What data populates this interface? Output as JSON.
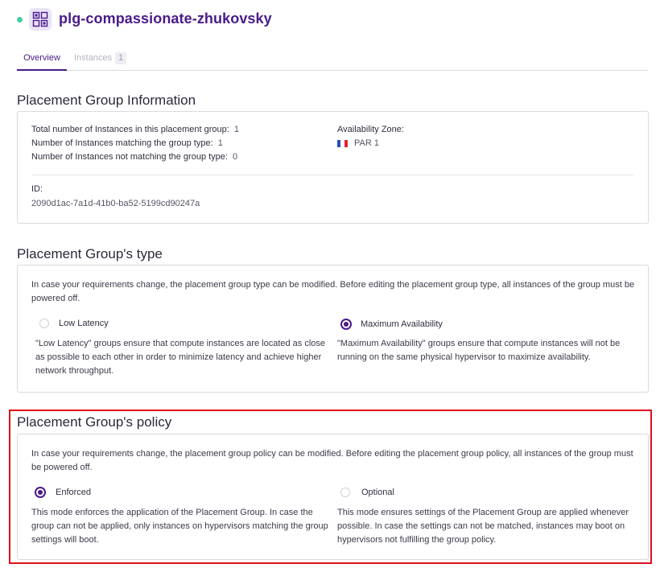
{
  "header": {
    "title": "plg-compassionate-zhukovsky",
    "status_color": "#3ecf9e",
    "icon": "placement-group-icon"
  },
  "tabs": [
    {
      "label": "Overview",
      "active": true
    },
    {
      "label": "Instances",
      "badge": "1",
      "active": false
    }
  ],
  "info": {
    "title": "Placement Group Information",
    "total_label": "Total number of Instances in this placement group:",
    "total_value": "1",
    "matching_label": "Number of Instances matching the group type:",
    "matching_value": "1",
    "not_matching_label": "Number of Instances not matching the group type:",
    "not_matching_value": "0",
    "zone_label": "Availability Zone:",
    "zone_value": "PAR 1",
    "zone_flag": "france-flag-icon",
    "id_label": "ID:",
    "id_value": "2090d1ac-7a1d-41b0-ba52-5199cd90247a"
  },
  "type": {
    "title": "Placement Group's type",
    "intro": "In case your requirements change, the placement group type can be modified. Before editing the placement group type, all instances of the group must be powered off.",
    "options": [
      {
        "label": "Low Latency",
        "selected": false,
        "description": "\"Low Latency\" groups ensure that compute instances are located as close as possible to each other in order to minimize latency and achieve higher network throughput."
      },
      {
        "label": "Maximum Availability",
        "selected": true,
        "description": "\"Maximum Availability\" groups ensure that compute instances will not be running on the same physical hypervisor to maximize availability."
      }
    ]
  },
  "policy": {
    "title": "Placement Group's policy",
    "intro": "In case your requirements change, the placement group policy can be modified. Before editing the placement group policy, all instances of the group must be powered off.",
    "options": [
      {
        "label": "Enforced",
        "selected": true,
        "description": "This mode enforces the application of the Placement Group. In case the group can not be applied, only instances on hypervisors matching the group settings will boot."
      },
      {
        "label": "Optional",
        "selected": false,
        "description": "This mode ensures settings of the Placement Group are applied whenever possible. In case the settings can not be matched, instances may boot on hypervisors not fulfilling the group policy."
      }
    ]
  },
  "colors": {
    "accent": "#4a1a8a",
    "highlight": "#e0101c"
  }
}
